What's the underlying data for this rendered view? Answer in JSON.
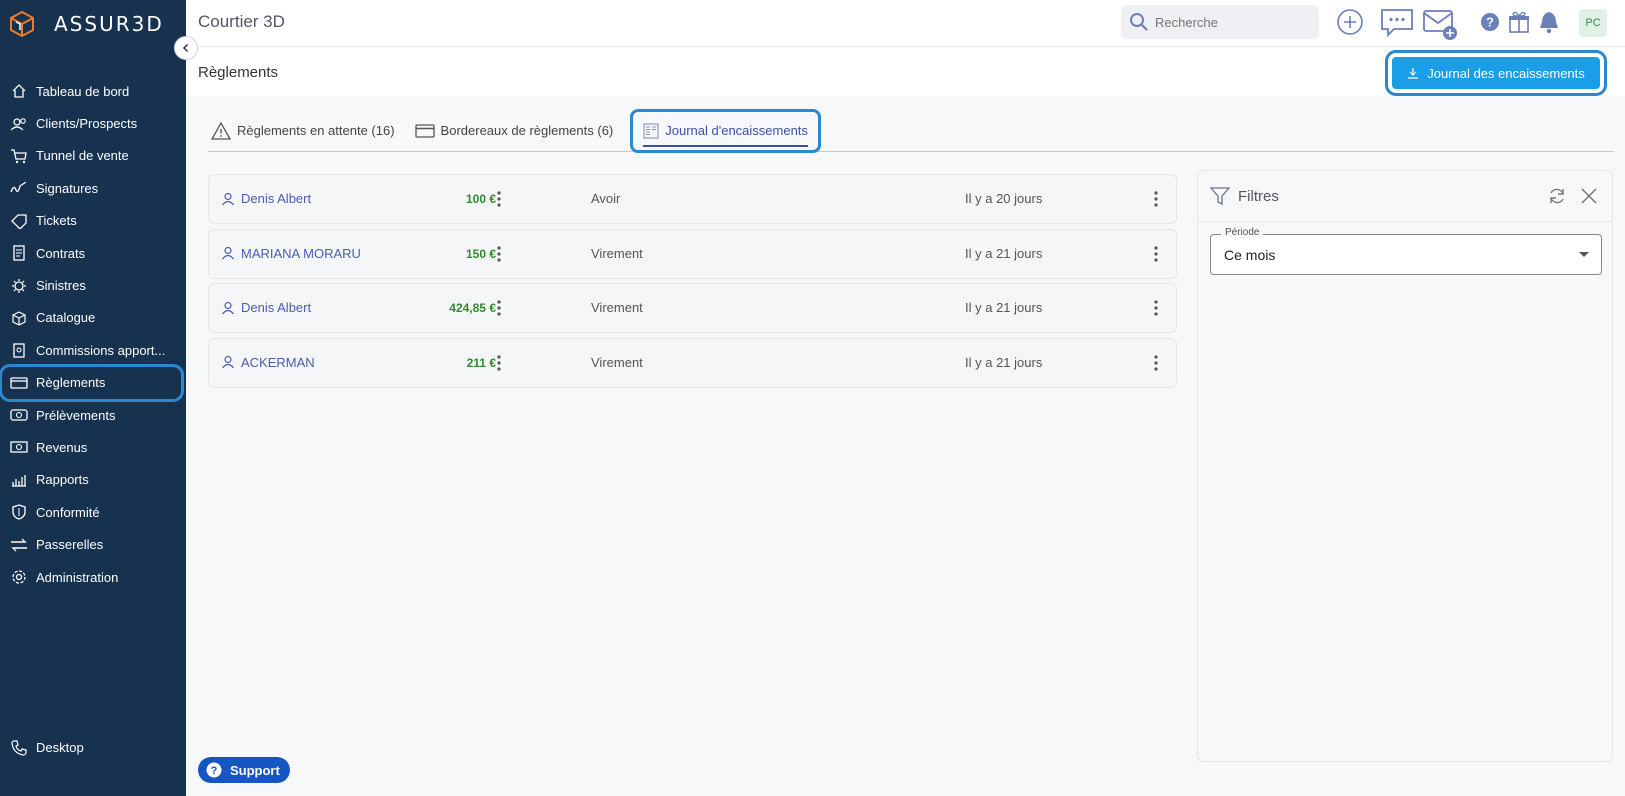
{
  "brand": {
    "name": "ASSUR3D"
  },
  "sidebar": {
    "items": [
      {
        "label": "Tableau de bord",
        "icon": "home-icon"
      },
      {
        "label": "Clients/Prospects",
        "icon": "users-icon"
      },
      {
        "label": "Tunnel de vente",
        "icon": "cart-icon"
      },
      {
        "label": "Signatures",
        "icon": "signature-icon"
      },
      {
        "label": "Tickets",
        "icon": "ticket-icon"
      },
      {
        "label": "Contrats",
        "icon": "contract-icon"
      },
      {
        "label": "Sinistres",
        "icon": "claim-icon"
      },
      {
        "label": "Catalogue",
        "icon": "box-icon"
      },
      {
        "label": "Commissions apport...",
        "icon": "commission-icon"
      },
      {
        "label": "Règlements",
        "icon": "card-icon",
        "active": true
      },
      {
        "label": "Prélèvements",
        "icon": "debit-icon"
      },
      {
        "label": "Revenus",
        "icon": "money-icon"
      },
      {
        "label": "Rapports",
        "icon": "chart-icon"
      },
      {
        "label": "Conformité",
        "icon": "shield-icon"
      },
      {
        "label": "Passerelles",
        "icon": "arrows-icon"
      },
      {
        "label": "Administration",
        "icon": "gear-icon"
      }
    ],
    "bottom": {
      "label": "Desktop",
      "icon": "phone-icon"
    }
  },
  "topbar": {
    "title": "Courtier 3D",
    "search_placeholder": "Recherche",
    "avatar": "PC"
  },
  "page": {
    "title": "Règlements",
    "export_button": "Journal des encaissements"
  },
  "tabs": [
    {
      "label": "Règlements en attente (16)",
      "icon": "warning-icon"
    },
    {
      "label": "Bordereaux de règlements (6)",
      "icon": "card-icon"
    },
    {
      "label": "Journal d'encaissements",
      "icon": "journal-icon",
      "active": true
    }
  ],
  "rows": [
    {
      "client": "Denis Albert",
      "amount": "100 €",
      "mode": "Avoir",
      "date": "Il y a 20 jours"
    },
    {
      "client": "MARIANA MORARU",
      "amount": "150 €",
      "mode": "Virement",
      "date": "Il y a 21 jours"
    },
    {
      "client": "Denis Albert",
      "amount": "424,85 €",
      "mode": "Virement",
      "date": "Il y a 21 jours"
    },
    {
      "client": "ACKERMAN",
      "amount": "211 €",
      "mode": "Virement",
      "date": "Il y a 21 jours"
    }
  ],
  "filters": {
    "title": "Filtres",
    "period_label": "Période",
    "period_value": "Ce mois"
  },
  "support": {
    "label": "Support"
  },
  "colors": {
    "sidebar": "#16324f",
    "accent": "#1a9ee8",
    "link": "#4a5db0",
    "amount": "#2e8b2e",
    "highlight": "#2a87d1"
  }
}
